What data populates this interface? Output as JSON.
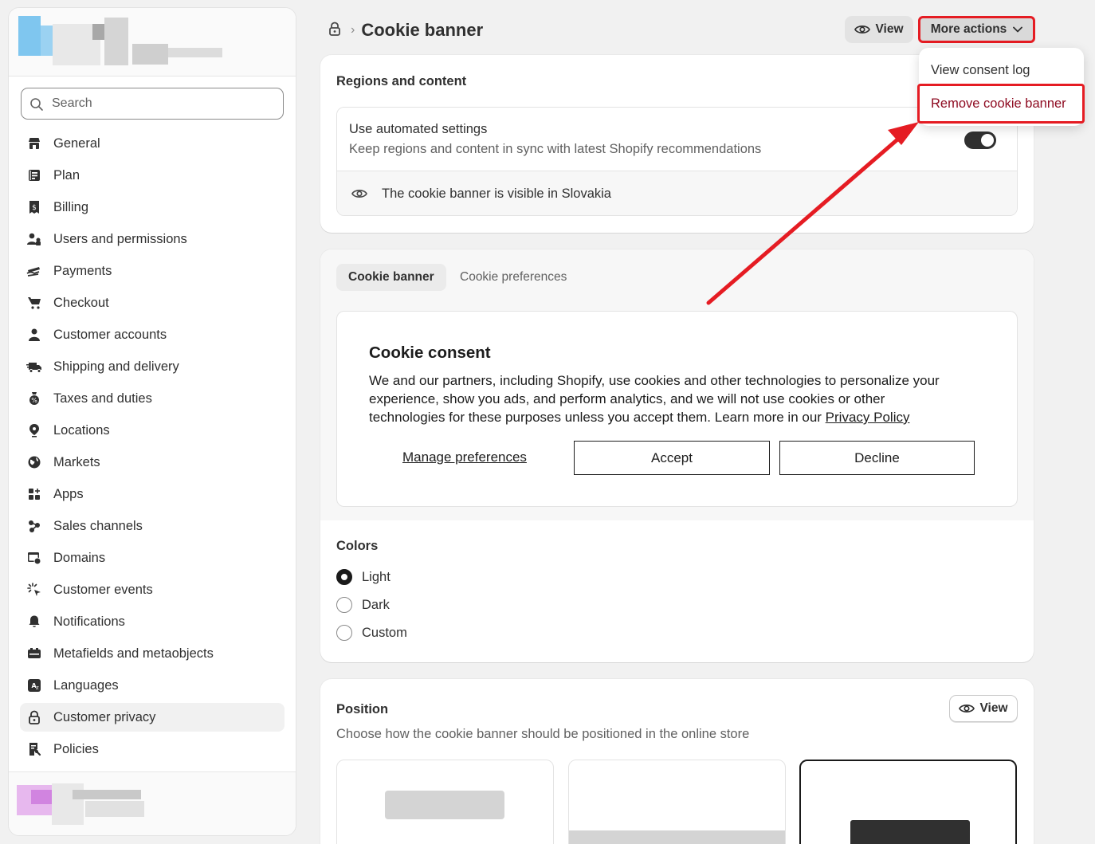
{
  "sidebar": {
    "search_placeholder": "Search",
    "items": [
      {
        "label": "General",
        "icon": "store-icon"
      },
      {
        "label": "Plan",
        "icon": "plan-icon"
      },
      {
        "label": "Billing",
        "icon": "billing-icon"
      },
      {
        "label": "Users and permissions",
        "icon": "users-icon"
      },
      {
        "label": "Payments",
        "icon": "payments-icon"
      },
      {
        "label": "Checkout",
        "icon": "cart-icon"
      },
      {
        "label": "Customer accounts",
        "icon": "person-icon"
      },
      {
        "label": "Shipping and delivery",
        "icon": "truck-icon"
      },
      {
        "label": "Taxes and duties",
        "icon": "tax-icon"
      },
      {
        "label": "Locations",
        "icon": "location-icon"
      },
      {
        "label": "Markets",
        "icon": "globe-icon"
      },
      {
        "label": "Apps",
        "icon": "apps-icon"
      },
      {
        "label": "Sales channels",
        "icon": "channels-icon"
      },
      {
        "label": "Domains",
        "icon": "domains-icon"
      },
      {
        "label": "Customer events",
        "icon": "events-icon"
      },
      {
        "label": "Notifications",
        "icon": "bell-icon"
      },
      {
        "label": "Metafields and metaobjects",
        "icon": "metafields-icon"
      },
      {
        "label": "Languages",
        "icon": "languages-icon"
      },
      {
        "label": "Customer privacy",
        "icon": "lock-icon",
        "active": true
      },
      {
        "label": "Policies",
        "icon": "policies-icon"
      }
    ]
  },
  "header": {
    "separator": "›",
    "title": "Cookie banner",
    "view_label": "View",
    "more_actions_label": "More actions"
  },
  "dropdown": {
    "items": [
      "View consent log",
      "Remove cookie banner"
    ]
  },
  "regions": {
    "title": "Regions and content",
    "automated_title": "Use automated settings",
    "automated_sub": "Keep regions and content in sync with latest Shopify recommendations",
    "visibility_text": "The cookie banner is visible in Slovakia"
  },
  "tabs": {
    "active": "Cookie banner",
    "inactive": "Cookie preferences"
  },
  "preview": {
    "title": "Cookie consent",
    "text": "We and our partners, including Shopify, use cookies and other technologies to personalize your experience, show you ads, and perform analytics, and we will not use cookies or other technologies for these purposes unless you accept them. Learn more in our ",
    "link": "Privacy Policy",
    "manage": "Manage preferences",
    "accept": "Accept",
    "decline": "Decline"
  },
  "colors": {
    "title": "Colors",
    "options": [
      "Light",
      "Dark",
      "Custom"
    ],
    "selected": "Light"
  },
  "position": {
    "title": "Position",
    "view_label": "View",
    "subtitle": "Choose how the cookie banner should be positioned in the online store"
  },
  "accent": {
    "annotation_red": "#e51c23",
    "critical_text": "#8e0b21"
  }
}
